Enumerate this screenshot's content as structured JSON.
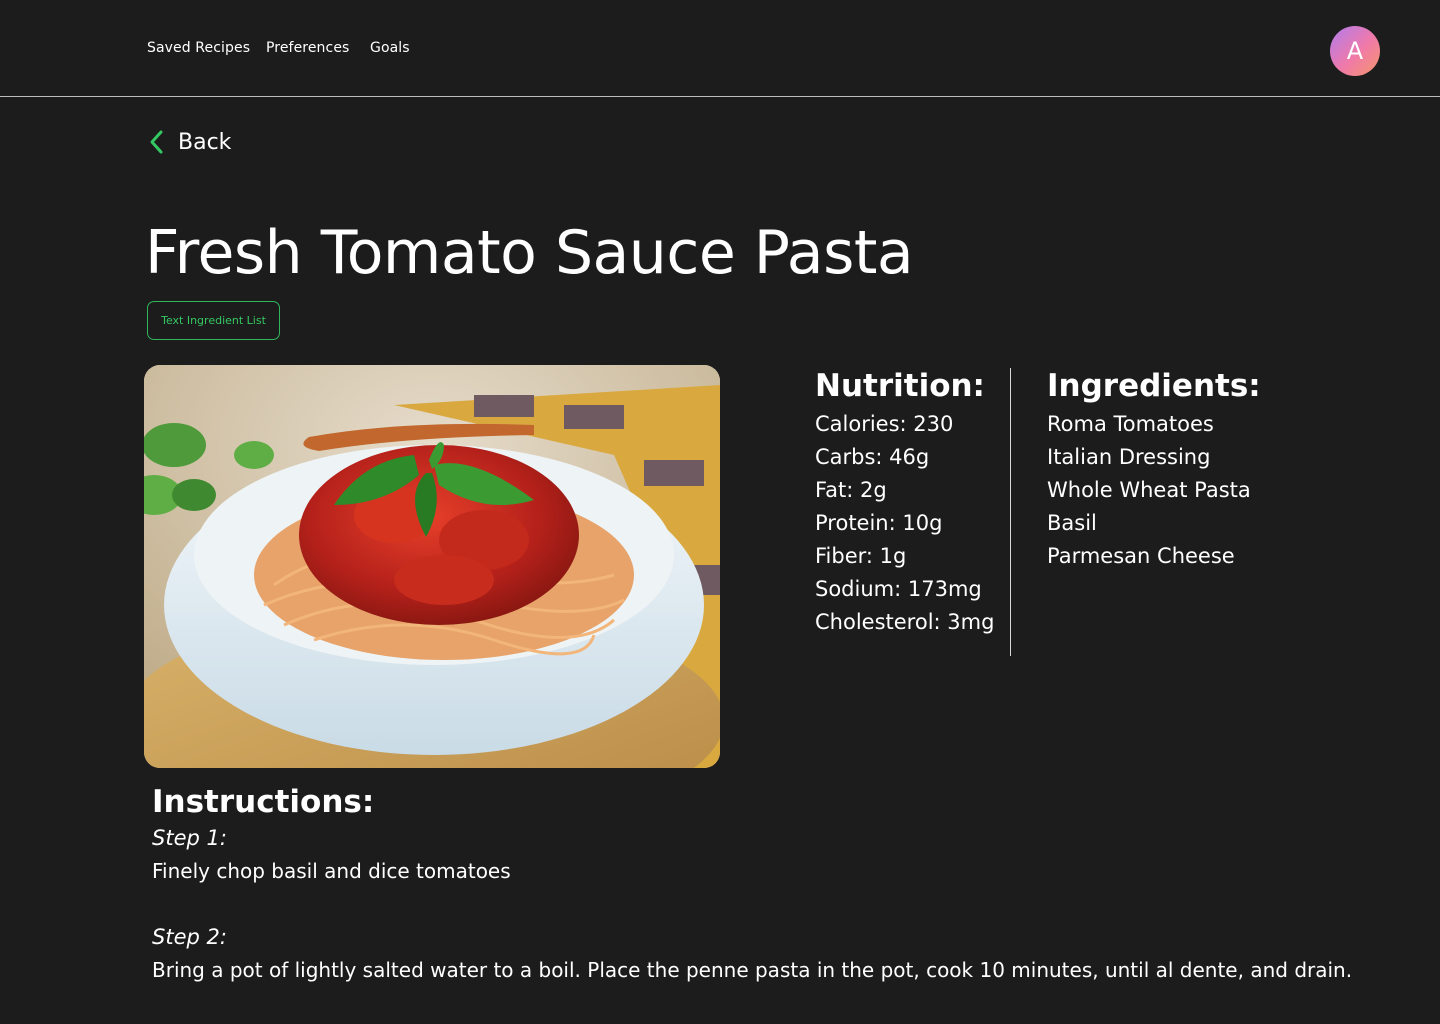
{
  "nav": {
    "items": [
      "Saved Recipes",
      "Preferences",
      "Goals"
    ],
    "avatar_initial": "A"
  },
  "back": {
    "label": "Back"
  },
  "recipe": {
    "title": "Fresh Tomato Sauce Pasta",
    "text_ingredients_button": "Text Ingredient List"
  },
  "nutrition": {
    "heading": "Nutrition:",
    "items": [
      "Calories: 230",
      "Carbs: 46g",
      "Fat: 2g",
      "Protein: 10g",
      "Fiber: 1g",
      "Sodium: 173mg",
      "Cholesterol: 3mg"
    ]
  },
  "ingredients": {
    "heading": "Ingredients:",
    "items": [
      "Roma Tomatoes",
      "Italian Dressing",
      "Whole Wheat Pasta",
      "Basil",
      "Parmesan Cheese"
    ]
  },
  "instructions": {
    "heading": "Instructions:",
    "steps": [
      {
        "label": "Step 1:",
        "text": "Finely chop basil and dice tomatoes"
      },
      {
        "label": "Step 2:",
        "text": "Bring a pot of lightly salted water to a boil. Place the penne pasta in the pot, cook 10 minutes, until al dente, and drain."
      }
    ]
  },
  "colors": {
    "background": "#1c1c1c",
    "accent": "#34c862",
    "text": "#ffffff"
  },
  "icons": {
    "back": "chevron-left-icon"
  }
}
